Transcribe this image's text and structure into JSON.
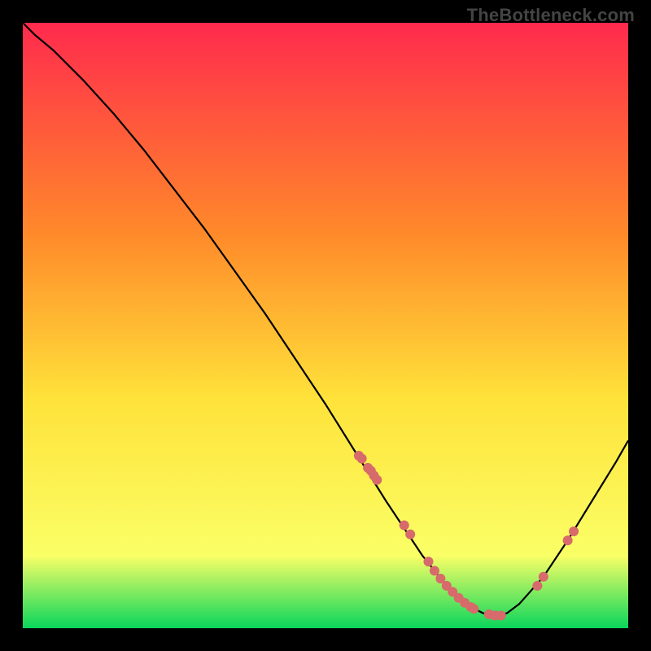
{
  "watermark": "TheBottleneck.com",
  "chart_data": {
    "type": "line",
    "title": "",
    "xlabel": "",
    "ylabel": "",
    "xlim": [
      0,
      100
    ],
    "ylim": [
      0,
      100
    ],
    "grid": false,
    "legend": null,
    "gradient_colors": {
      "top": "#ff2a4d",
      "mid_upper": "#ff8a2a",
      "mid": "#ffe23a",
      "mid_lower": "#faff66",
      "bottom": "#09d65b"
    },
    "series": [
      {
        "name": "bottleneck-curve",
        "color": "#000000",
        "x": [
          0,
          2,
          5,
          10,
          15,
          20,
          25,
          30,
          35,
          40,
          45,
          50,
          55,
          60,
          62,
          64,
          66,
          68,
          70,
          72,
          74,
          76,
          78,
          80,
          82,
          86,
          90,
          94,
          98,
          100
        ],
        "y": [
          100,
          98,
          95.5,
          90.5,
          85,
          79,
          72.5,
          66,
          59,
          52,
          44.5,
          37,
          29,
          21,
          18,
          15,
          12,
          9.5,
          7,
          5,
          3.5,
          2.5,
          2,
          2.5,
          4,
          8.5,
          14.5,
          21,
          27.5,
          31
        ]
      }
    ],
    "points": {
      "name": "marker-dots",
      "color": "#d76a6a",
      "radius": 6,
      "x": [
        55.5,
        56,
        57,
        57.5,
        58,
        58.5,
        63,
        64,
        67,
        68,
        69,
        70,
        71,
        72,
        73,
        74,
        74.5,
        77,
        78,
        79,
        85,
        86,
        90,
        91
      ],
      "y": [
        28.5,
        28,
        26.5,
        26,
        25.2,
        24.5,
        17,
        15.5,
        11,
        9.5,
        8.2,
        7,
        6,
        5,
        4.2,
        3.5,
        3.2,
        2.3,
        2.1,
        2.1,
        7,
        8.5,
        14.5,
        16
      ]
    }
  }
}
